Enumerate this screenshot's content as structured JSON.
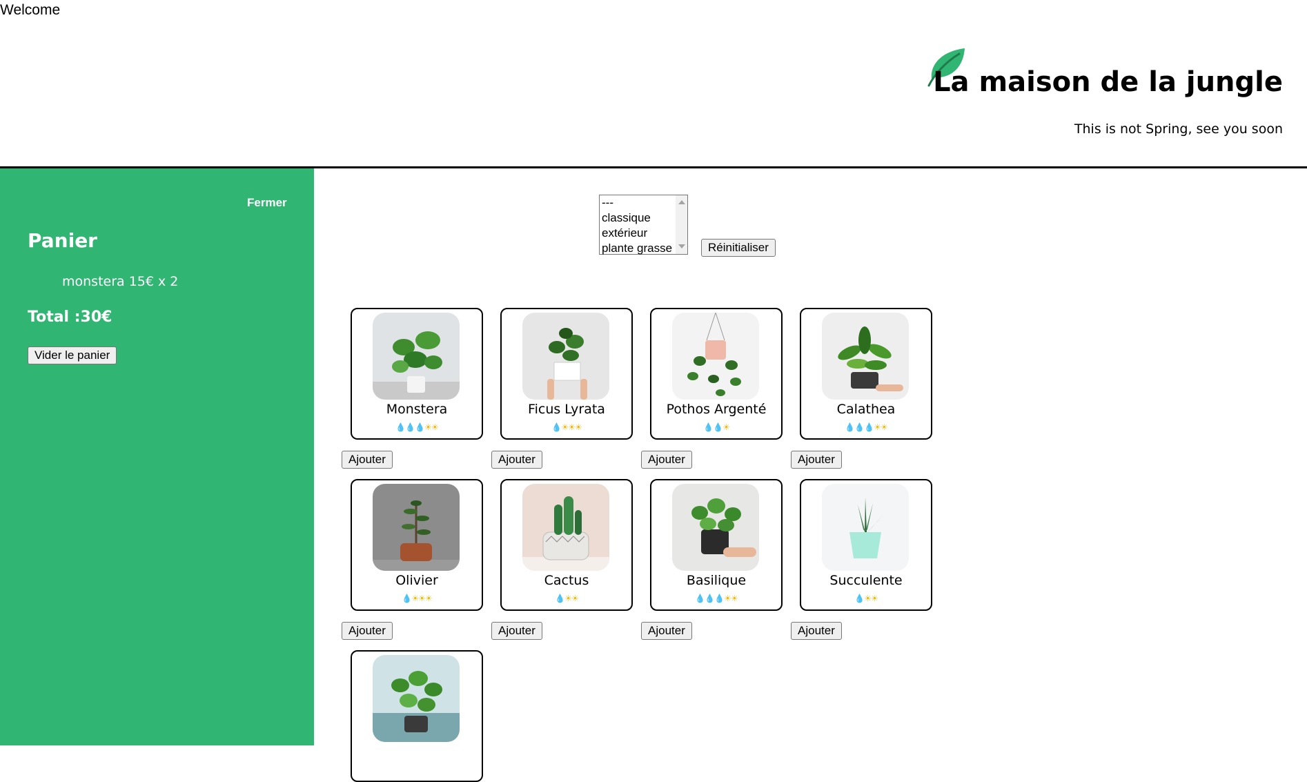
{
  "welcome": "Welcome",
  "brand": {
    "title": "La maison de la jungle",
    "subtitle": "This is not Spring, see you soon",
    "logo": "leaf-icon",
    "accent": "#31b572"
  },
  "cart": {
    "close_label": "Fermer",
    "title": "Panier",
    "items": [
      {
        "label": "monstera 15€ x 2"
      }
    ],
    "total": "Total :30€",
    "empty_label": "Vider le panier"
  },
  "filter": {
    "options": [
      "---",
      "classique",
      "extérieur",
      "plante grasse"
    ],
    "reset_label": "Réinitialiser"
  },
  "plants": [
    {
      "name": "Monstera",
      "water": 3,
      "light": 2,
      "add_label": "Ajouter"
    },
    {
      "name": "Ficus Lyrata",
      "water": 1,
      "light": 3,
      "add_label": "Ajouter"
    },
    {
      "name": "Pothos Argenté",
      "water": 2,
      "light": 1,
      "add_label": "Ajouter"
    },
    {
      "name": "Calathea",
      "water": 3,
      "light": 2,
      "add_label": "Ajouter"
    },
    {
      "name": "Olivier",
      "water": 1,
      "light": 3,
      "add_label": "Ajouter"
    },
    {
      "name": "Cactus",
      "water": 1,
      "light": 2,
      "add_label": "Ajouter"
    },
    {
      "name": "Basilique",
      "water": 3,
      "light": 2,
      "add_label": "Ajouter"
    },
    {
      "name": "Succulente",
      "water": 1,
      "light": 2,
      "add_label": "Ajouter"
    },
    {
      "name": "",
      "water": 0,
      "light": 0,
      "add_label": ""
    }
  ]
}
